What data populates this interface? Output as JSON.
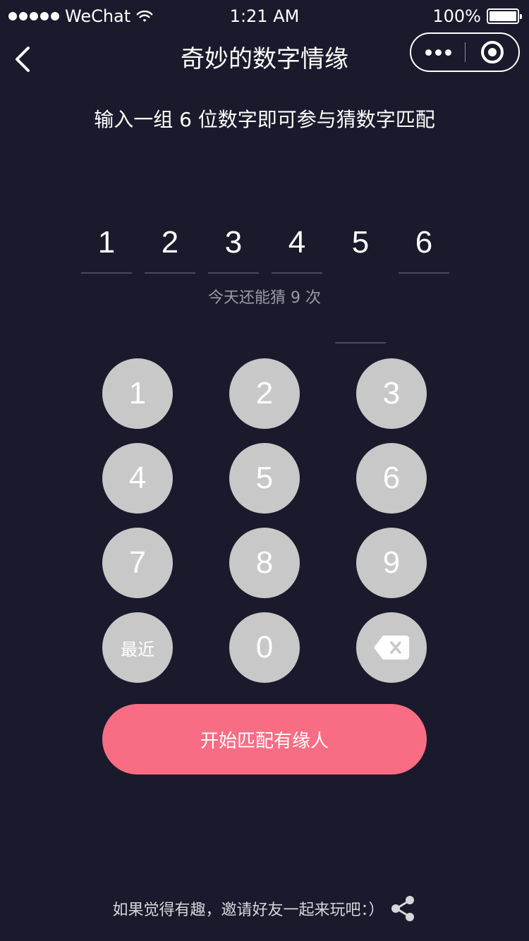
{
  "status_bar": {
    "carrier": "WeChat",
    "time": "1:21 AM",
    "battery": "100%",
    "icons": [
      "signal-dots-icon",
      "wifi-icon",
      "battery-icon"
    ]
  },
  "nav": {
    "title": "奇妙的数字情缘",
    "icons": [
      "back-chevron-icon",
      "more-dots-icon",
      "close-target-icon"
    ]
  },
  "content": {
    "instruction": "输入一组 6 位数字即可参与猜数字匹配",
    "digits": [
      "1",
      "2",
      "3",
      "4",
      "5",
      "6"
    ],
    "remaining": "今天还能猜 9 次"
  },
  "keypad": {
    "keys": [
      "1",
      "2",
      "3",
      "4",
      "5",
      "6",
      "7",
      "8",
      "9",
      "最近",
      "0"
    ],
    "delete_icon": "backspace-icon"
  },
  "start_button": "开始匹配有缘人",
  "footer": {
    "invite_text": "如果觉得有趣，邀请好友一起来玩吧：）",
    "share_icon": "share-icon"
  },
  "colors": {
    "background": "#1b1a2c",
    "key": "#c8c8c8",
    "accent": "#f96d84",
    "muted_text": "#9b9ba6"
  }
}
